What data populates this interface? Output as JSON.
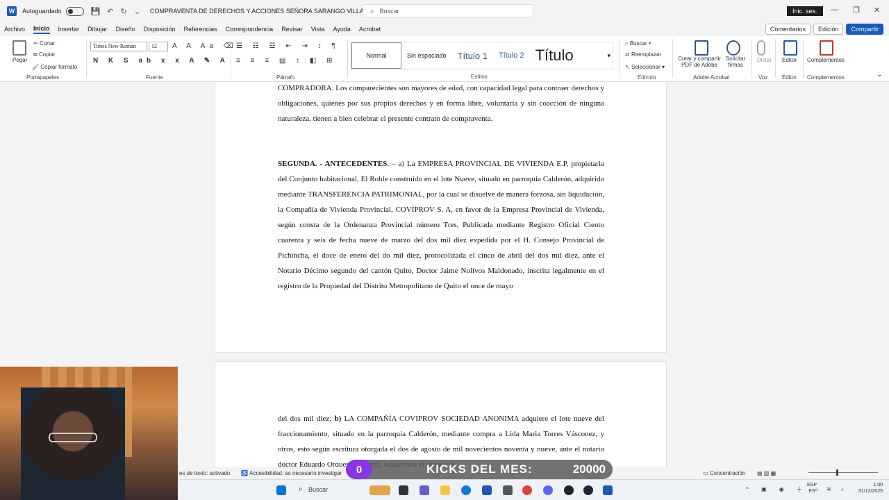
{
  "titlebar": {
    "app_icon": "word-icon",
    "autosave_label": "Autoguardado",
    "doc_title": "COMPRAVENTA DE DERECHOS Y ACCIONES SEÑORA SARANGO VILLACIS",
    "search_placeholder": "Buscar",
    "signin_label": "Inic. ses."
  },
  "menu": [
    "Archivo",
    "Inicio",
    "Insertar",
    "Dibujar",
    "Diseño",
    "Disposición",
    "Referencias",
    "Correspondencia",
    "Revisar",
    "Vista",
    "Ayuda",
    "Acrobat"
  ],
  "menu_active": "Inicio",
  "right_buttons": {
    "comments": "Comentarios",
    "editing": "Edición",
    "share": "Compartir"
  },
  "ribbon": {
    "clipboard": {
      "paste": "Pegar",
      "cut": "Cortar",
      "copy": "Copiar",
      "format_painter": "Copiar formato",
      "label": "Portapapeles"
    },
    "font": {
      "font_name": "Times New Roman",
      "font_size": "12",
      "label": "Fuente"
    },
    "paragraph": {
      "label": "Párrafo"
    },
    "styles": {
      "items": [
        "Normal",
        "Sin espaciado",
        "Título 1",
        "Título 2",
        "Título"
      ],
      "label": "Estilos"
    },
    "editing": {
      "find": "Buscar",
      "replace": "Reemplazar",
      "select": "Seleccionar",
      "label": "Edición"
    },
    "adobe": {
      "create": "Crear y compartir PDF de Adobe",
      "request": "Solicitar firmas",
      "label": "Adobe Acrobat"
    },
    "voice": {
      "dictate": "Dictar",
      "label": "Voz"
    },
    "editor": {
      "name": "Editor",
      "label": "Editor"
    },
    "addins": {
      "name": "Complementos",
      "label": "Complementos"
    }
  },
  "document": {
    "p1": "COMPRADORA. Los comparecientes son mayores de edad, con capacidad legal para contraer derechos y obligaciones, quienes por sus propios derechos y en forma libre, voluntaria y sin coacción de ninguna naturaleza, tienen a bien celebrar el presente contrato de compraventa.",
    "p2_heading": "SEGUNDA. - ANTECEDENTES",
    "p2_body": ". – a) La EMPRESA PROVINCIAL DE VIVIENDA E.P, propietaria del Conjunto habitacional, El Roble construido en el lote Nueve, situado en parroquia Calderón, adquirido mediante TRANSFERENCIA PATRIMONIAL, por la cual se disuelve de manera forzosa, sin liquidación, la Compañía de Vivienda Provincial, COVIPROV S. A, en favor de la Empresa Provincial de Vivienda, según consta de la Ordenanza Provincial número Tres, Publicada mediante Registro Oficial Ciento cuarenta y seis de fecha nueve de marzo del dos mil diez expedida por el H. Consejo Provincial de Pichincha, el doce de enero del do mil diez, protocolizada el cinco de abril del dos mil diez, ante el Notario Décimo segundo del cantón Quito, Doctor Jaime Nolivos Maldonado, inscrita legalmente en el registro de la Propiedad del Distrito Metropolitano de Quito el once de mayo",
    "p3_start": "del dos mil diez; ",
    "p3_bold": "b)",
    "p3_body": " LA COMPAÑÍA COVIPROV SOCIEDAD ANONIMA adquiere el lote nueve del fraccionamiento, situado en la parroquia Calderón, mediante compra a Lida Maria Torres Vásconez, y otros, esto según escritura otorgada el dos de agosto de mil novecientos noventa y nueve, ante el notario doctor Eduardo Orquera e inscrita legalmente el quince de"
  },
  "statusbar": {
    "text_prediction": "es de texto: activado",
    "accessibility": "Accesibilidad: es necesario investigar",
    "focus": "Concentración"
  },
  "overlay": {
    "kicks_count": "0",
    "kicks_label": "KICKS DEL MES:",
    "kicks_goal": "20000"
  },
  "taskbar": {
    "search": "Buscar",
    "lang": "ESP",
    "region": "ES",
    "time": "1:00",
    "date": "31/12/2025"
  }
}
